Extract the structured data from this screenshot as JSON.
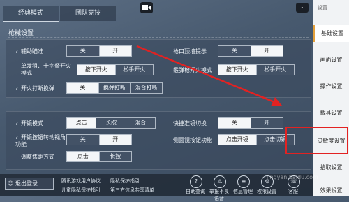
{
  "tabs": [
    "经典模式",
    "团队竞技"
  ],
  "camera_icon": "camera-icon",
  "window_ctrl": {
    "close": "⊘",
    "min": "-"
  },
  "section1": {
    "title": "枪械设置",
    "rows": [
      {
        "label": "辅助瞄准",
        "options": [
          "关",
          "开"
        ],
        "selected": 1,
        "q": "?"
      },
      {
        "label": "单发狙、十字弩开火模式",
        "options": [
          "按下开火",
          "松手开火"
        ],
        "selected": 0,
        "q": ""
      },
      {
        "label": "开火打断换弹",
        "options": [
          "关",
          "换弹打断",
          "混合打断"
        ],
        "selected": 0,
        "q": "?"
      }
    ],
    "right_rows": [
      {
        "label": "枪口顶墙提示",
        "options": [
          "关",
          "开"
        ],
        "selected": 1
      },
      {
        "label": "霰弹枪开火模式",
        "options": [
          "按下开火",
          "松手开火"
        ],
        "selected": 0
      }
    ]
  },
  "section2": {
    "rows": [
      {
        "label": "开镜模式",
        "options": [
          "点击",
          "长按",
          "混合"
        ],
        "selected": 0,
        "q": "?"
      },
      {
        "label": "开镜按钮转动视角功能",
        "options": [
          "关",
          "开"
        ],
        "selected": 1,
        "q": "?"
      },
      {
        "label": "调整焦距方式",
        "options": [
          "点击",
          "长按"
        ],
        "selected": 0,
        "q": ""
      }
    ],
    "right_rows": [
      {
        "label": "快捷准镜切换",
        "options": [
          "关",
          "开"
        ],
        "selected": 0
      },
      {
        "label": "侧面镜按钮功能",
        "options": [
          "点击开镜",
          "点击切镜"
        ],
        "selected": 0
      }
    ]
  },
  "sidebar": {
    "top_label": "设置",
    "items": [
      "基础设置",
      "画面设置",
      "操作设置",
      "载具设置",
      "灵敏度设置",
      "拾取设置",
      "效果设置"
    ],
    "active": 0
  },
  "bottom": {
    "logout": "退出登录",
    "links": [
      "腾讯游戏用户协议",
      "隐私保护指引",
      "儿童隐私保护指引",
      "第三方信息共享清单"
    ],
    "actions": [
      {
        "icon": "auto-query-icon",
        "glyph": "?",
        "label": "自助查询"
      },
      {
        "icon": "report-voice-icon",
        "glyph": "⚠",
        "label": "举报不良语音"
      },
      {
        "icon": "info-manage-icon",
        "glyph": "≡",
        "label": "信息管理"
      },
      {
        "icon": "privacy-settings-icon",
        "glyph": "⚙",
        "label": "权限设置"
      },
      {
        "icon": "customer-service-icon",
        "glyph": "☏",
        "label": "客服"
      }
    ]
  },
  "watermark": "jingyan.baidu.com",
  "colors": {
    "highlight": "#e22222",
    "active_border": "#e4a03a"
  }
}
